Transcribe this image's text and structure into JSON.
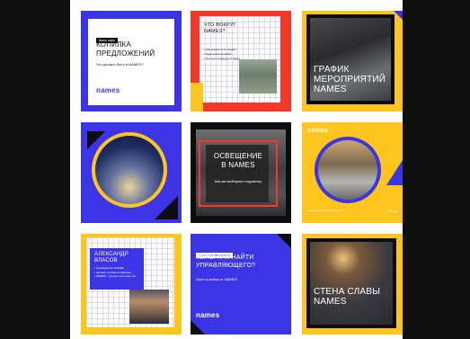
{
  "tiles": {
    "t1": {
      "label": "Ваше идеи",
      "title": "КОПИЛКА ПРЕДЛОЖЕНИЙ",
      "subtitle": "Что должно быть в NAMES?",
      "logo": "names"
    },
    "t2": {
      "title": "ЧТО ВОКРУГ NAMES?",
      "bullets": [
        "Где отдохнуть в городе?",
        "Куда пойти на обед?",
        "Что есть в радиусе 5 минут"
      ]
    },
    "t3": {
      "title": "ГРАФИК МЕРОПРИЯТИЙ NAMES"
    },
    "t4": {},
    "t5": {
      "title": "ОСВЕЩЕНИЕ В NAMES",
      "subtitle": "Как мы выбирали подсветку"
    },
    "t6": {
      "logo": "names",
      "caption": "Оформление пространства",
      "tag": "NAMES"
    },
    "t7": {
      "title": "АЛЕКСАНДР ВЛАСОВ",
      "bullets": [
        "Руководитель NAMES",
        "Эксперт в области офисных",
        "NAMES – лучшее пространство"
      ]
    },
    "t8": {
      "label": "Полезные материалы",
      "title": "КЕЙС: КАК НАЙТИ УПРАВЛЯЮЩЕГО?",
      "subtitle": "Опыт и кейсы от NAMES",
      "logo": "names"
    },
    "t9": {
      "title": "СТЕНА СЛАВЫ NAMES"
    }
  },
  "colors": {
    "blue": "#3b35e6",
    "yellow": "#ffc51f",
    "black": "#0d0d10",
    "red": "#f23a2c"
  }
}
